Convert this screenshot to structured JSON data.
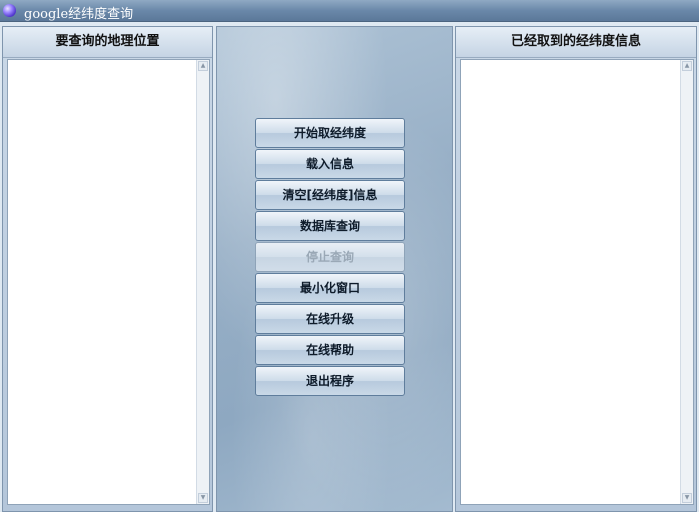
{
  "window": {
    "title": "google经纬度查询"
  },
  "left_panel": {
    "header": "要查询的地理位置",
    "content": ""
  },
  "right_panel": {
    "header": "已经取到的经纬度信息",
    "content": ""
  },
  "buttons": [
    {
      "label": "开始取经纬度",
      "enabled": true
    },
    {
      "label": "载入信息",
      "enabled": true
    },
    {
      "label": "清空[经纬度]信息",
      "enabled": true
    },
    {
      "label": "数据库查询",
      "enabled": true
    },
    {
      "label": "停止查询",
      "enabled": false
    },
    {
      "label": "最小化窗口",
      "enabled": true
    },
    {
      "label": "在线升级",
      "enabled": true
    },
    {
      "label": "在线帮助",
      "enabled": true
    },
    {
      "label": "退出程序",
      "enabled": true
    }
  ]
}
